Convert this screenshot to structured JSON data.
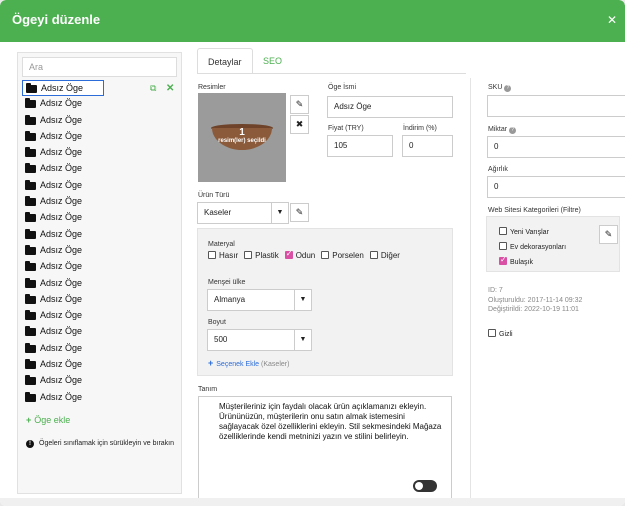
{
  "dialog": {
    "title": "Ögeyi düzenle",
    "close_icon": "close-icon"
  },
  "left": {
    "search_placeholder": "Ara",
    "items": [
      "Adsız Öge",
      "Adsız Öge",
      "Adsız Öge",
      "Adsız Öge",
      "Adsız Öge",
      "Adsız Öge",
      "Adsız Öge",
      "Adsız Öge",
      "Adsız Öge",
      "Adsız Öge",
      "Adsız Öge",
      "Adsız Öge",
      "Adsız Öge",
      "Adsız Öge",
      "Adsız Öge",
      "Adsız Öge",
      "Adsız Öge",
      "Adsız Öge",
      "Adsız Öge",
      "Adsız Öge"
    ],
    "add_item": "Öge ekle",
    "hint": "Ögeleri sınıflamak için sürükleyin ve bırakın"
  },
  "tabs": {
    "details": "Detaylar",
    "seo": "SEO"
  },
  "images": {
    "label": "Resimler",
    "count": "1",
    "selected_text": "resim(ler) seçildi"
  },
  "item_name": {
    "label": "Öge İsmi",
    "value": "Adsız Öge"
  },
  "price": {
    "label": "Fiyat (TRY)",
    "value": "105"
  },
  "discount": {
    "label": "İndirim (%)",
    "value": "0"
  },
  "product_type": {
    "label": "Ürün Türü",
    "value": "Kaseler"
  },
  "material": {
    "label": "Materyal",
    "options": [
      {
        "label": "Hasır",
        "checked": false
      },
      {
        "label": "Plastik",
        "checked": false
      },
      {
        "label": "Odun",
        "checked": true
      },
      {
        "label": "Porselen",
        "checked": false
      },
      {
        "label": "Diğer",
        "checked": false
      }
    ]
  },
  "origin": {
    "label": "Menşei ülke",
    "value": "Almanya"
  },
  "size": {
    "label": "Boyut",
    "value": "500"
  },
  "add_variant": {
    "label": "Seçenek Ekle",
    "muted": "(Kaseler)"
  },
  "description": {
    "label": "Tanım",
    "text": "Müşterileriniz için faydalı olacak ürün açıklamanızı ekleyin. Ürününüzün, müşterilerin onu satın almak istemesini sağlayacak özel özelliklerini ekleyin. Stil sekmesindeki Mağaza özelliklerinde kendi metninizi yazın ve stilini belirleyin."
  },
  "sku": {
    "label": "SKU",
    "value": ""
  },
  "quantity": {
    "label": "Miktar",
    "value": "0"
  },
  "weight": {
    "label": "Ağırlık",
    "value": "0"
  },
  "categories": {
    "label": "Web Sitesi Kategorileri (Filtre)",
    "items": [
      {
        "label": "Yeni Varışlar",
        "checked": false
      },
      {
        "label": "Ev dekorasyonları",
        "checked": false
      },
      {
        "label": "Bulaşık",
        "checked": true
      }
    ]
  },
  "meta": {
    "id": "ID: 7",
    "created": "Oluşturuldu: 2017-11-14 09:32",
    "modified": "Değiştirildi: 2022-10-19 11:01"
  },
  "hidden": {
    "label": "Gizli",
    "checked": false
  },
  "colors": {
    "accent": "#4caf50",
    "link": "#2b6cd8",
    "checkbox_on": "#d94fa3"
  }
}
